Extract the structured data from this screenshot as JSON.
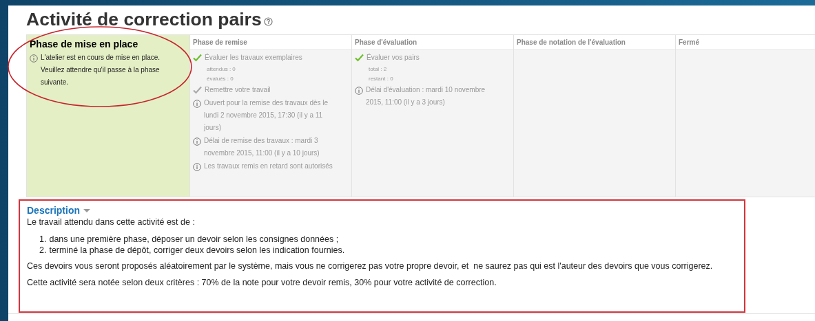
{
  "title": "Activité de correction pairs",
  "phases": [
    {
      "title": "Phase de mise en place",
      "current": true,
      "items": [
        {
          "kind": "info",
          "text": "L'atelier est en cours de mise en place. Veuillez attendre qu'il passe à la phase suivante."
        }
      ]
    },
    {
      "title": "Phase de remise",
      "current": false,
      "items": [
        {
          "kind": "done",
          "text": "Évaluer les travaux exemplaires",
          "details": [
            "attendus : 0",
            "évalués : 0"
          ]
        },
        {
          "kind": "todo",
          "text": "Remettre votre travail"
        },
        {
          "kind": "info",
          "text": "Ouvert pour la remise des travaux dès le lundi 2 novembre 2015, 17:30 (il y a 11 jours)"
        },
        {
          "kind": "info",
          "text": "Délai de remise des travaux : mardi 3 novembre 2015, 11:00 (il y a 10 jours)"
        },
        {
          "kind": "info",
          "text": "Les travaux remis en retard sont autorisés"
        }
      ]
    },
    {
      "title": "Phase d'évaluation",
      "current": false,
      "items": [
        {
          "kind": "done",
          "text": "Évaluer vos pairs",
          "details": [
            "total : 2",
            "restant : 0"
          ]
        },
        {
          "kind": "info",
          "text": "Délai d'évaluation : mardi 10 novembre 2015, 11:00 (il y a 3 jours)"
        }
      ]
    },
    {
      "title": "Phase de notation de l'évaluation",
      "current": false
    },
    {
      "title": "Fermé",
      "current": false
    }
  ],
  "description": {
    "heading": "Description",
    "intro": "Le travail attendu dans cette activité est de :",
    "steps": [
      {
        "number": "1.",
        "text": "dans une première phase, déposer un devoir selon les consignes données ;"
      },
      {
        "number": "2.",
        "text": "terminé la phase de dépôt, corriger deux devoirs selon les indication fournies."
      }
    ],
    "paragraphs": [
      "Ces devoirs vous seront proposés aléatoirement par le système, mais vous ne corrigerez pas votre propre devoir, et  ne saurez pas qui est l'auteur des devoirs que vous corrigerez.",
      "Cette activité sera notée selon deux critères : 70% de la note pour votre devoir remis, 30% pour votre activité de correction."
    ]
  },
  "annotations": {
    "ellipse_on_current_phase": true,
    "frame_on_description": true
  }
}
